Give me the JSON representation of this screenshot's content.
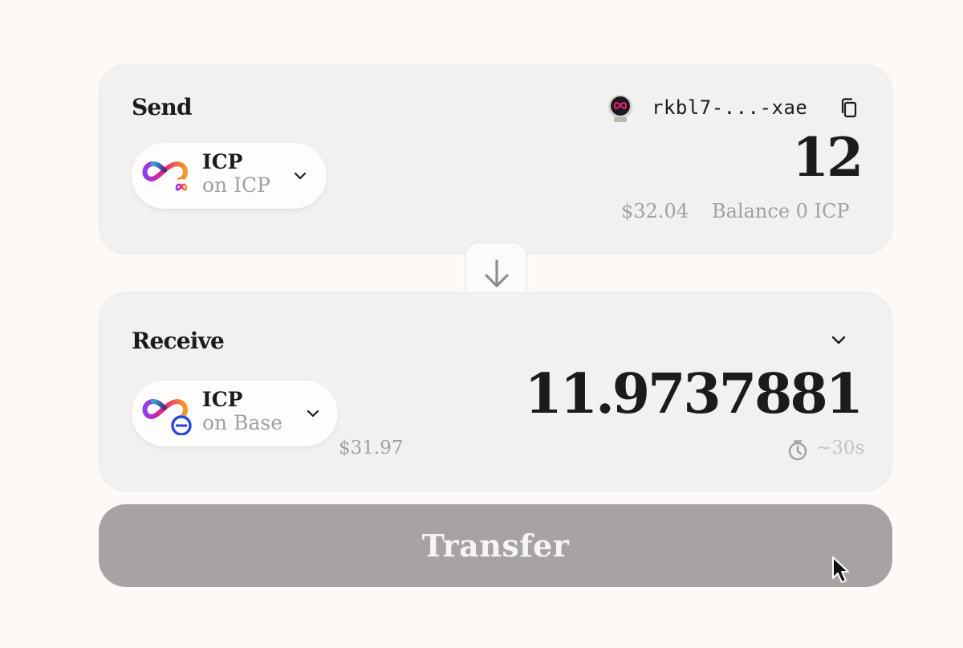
{
  "send": {
    "title": "Send",
    "token_symbol": "ICP",
    "token_network": "on ICP",
    "address": "rkbl7-...-xae",
    "amount": "12",
    "usd_value": "$32.04",
    "balance": "Balance 0 ICP"
  },
  "receive": {
    "title": "Receive",
    "token_symbol": "ICP",
    "token_network": "on Base",
    "amount": "11.9737881",
    "usd_value": "$31.97",
    "estimated_time": "~30s"
  },
  "transfer": {
    "label": "Transfer"
  },
  "icons": {
    "send_token": "icp-logo-icon",
    "send_network": "icp-network-badge-icon",
    "receive_token": "icp-logo-icon",
    "receive_network": "base-network-badge-icon",
    "avatar": "astronaut-avatar",
    "copy": "copy-icon",
    "swap": "arrow-down-icon",
    "timer": "timer-icon"
  },
  "colors": {
    "background": "#fcf9f6",
    "card": "#f3f1ef",
    "text": "#1c1b1b",
    "muted": "#a39f9c",
    "transfer_disabled": "#a6a3a2",
    "base_blue": "#2648e0"
  }
}
